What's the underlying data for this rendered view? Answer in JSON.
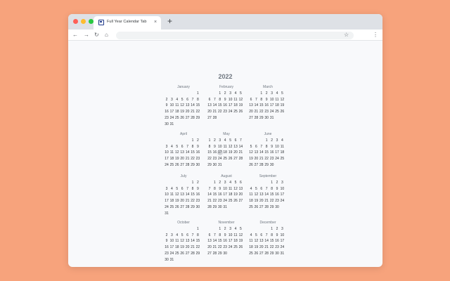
{
  "browser": {
    "tab_title": "Full Year Calendar Tab",
    "tab_close": "×",
    "new_tab": "+",
    "icons": {
      "back": "←",
      "forward": "→",
      "reload": "↻",
      "home": "⌂",
      "bookmark": "☆",
      "menu": "⋮"
    }
  },
  "calendar": {
    "year": "2022",
    "today": {
      "month": 5,
      "day": 17
    },
    "months": [
      {
        "name": "January",
        "first_weekday": 6,
        "days": 31
      },
      {
        "name": "February",
        "first_weekday": 2,
        "days": 28
      },
      {
        "name": "March",
        "first_weekday": 2,
        "days": 31
      },
      {
        "name": "April",
        "first_weekday": 5,
        "days": 30
      },
      {
        "name": "May",
        "first_weekday": 0,
        "days": 31
      },
      {
        "name": "June",
        "first_weekday": 3,
        "days": 30
      },
      {
        "name": "July",
        "first_weekday": 5,
        "days": 31
      },
      {
        "name": "August",
        "first_weekday": 1,
        "days": 31
      },
      {
        "name": "September",
        "first_weekday": 4,
        "days": 30
      },
      {
        "name": "October",
        "first_weekday": 6,
        "days": 31
      },
      {
        "name": "November",
        "first_weekday": 2,
        "days": 30
      },
      {
        "name": "December",
        "first_weekday": 4,
        "days": 31
      }
    ]
  }
}
